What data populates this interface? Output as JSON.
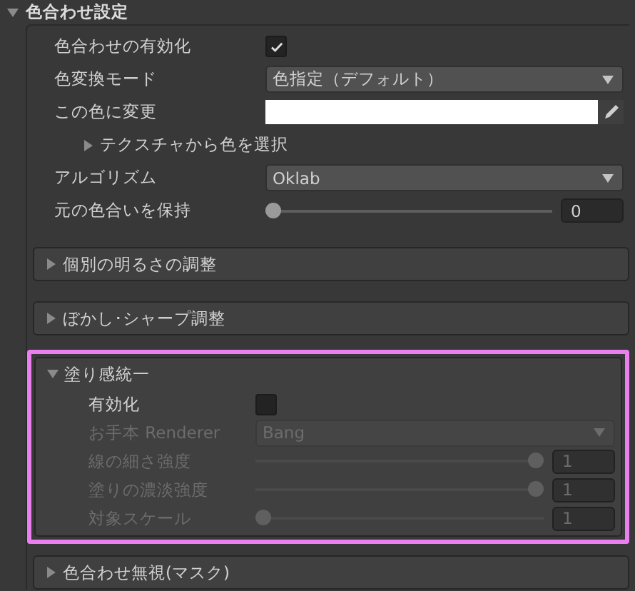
{
  "header": {
    "label": "色合わせ設定",
    "expanded": true
  },
  "rows": [
    {
      "kind": "checkbox",
      "label": "色合わせの有効化",
      "checked": true
    },
    {
      "kind": "dropdown",
      "label": "色変換モード",
      "value": "色指定（デフォルト）"
    },
    {
      "kind": "color",
      "label": "この色に変更",
      "color": "#ffffff"
    },
    {
      "kind": "foldout",
      "label": "テクスチャから色を選択",
      "expanded": false
    },
    {
      "kind": "dropdown",
      "label": "アルゴリズム",
      "value": "Oklab"
    },
    {
      "kind": "slider",
      "label": "元の色合いを保持",
      "level": 0,
      "value": "0"
    }
  ],
  "sections": [
    {
      "label": "個別の明るさの調整",
      "expanded": false,
      "highlighted": false
    },
    {
      "label": "ぼかし･シャープ調整",
      "expanded": false,
      "highlighted": false
    },
    {
      "label": "塗り感統一",
      "expanded": true,
      "highlighted": true,
      "rows": [
        {
          "kind": "checkbox",
          "label": "有効化",
          "checked": false,
          "disabled": false
        },
        {
          "kind": "dropdown",
          "label": "お手本 Renderer",
          "value": "Bang",
          "disabled": true
        },
        {
          "kind": "slider",
          "label": "線の細さ強度",
          "level": 1,
          "value": "1",
          "disabled": true
        },
        {
          "kind": "slider",
          "label": "塗りの濃淡強度",
          "level": 1,
          "value": "1",
          "disabled": true
        },
        {
          "kind": "slider",
          "label": "対象スケール",
          "level": 0,
          "value": "1",
          "disabled": true
        }
      ]
    },
    {
      "label": "色合わせ無視(マスク)",
      "expanded": false,
      "highlighted": false
    }
  ]
}
